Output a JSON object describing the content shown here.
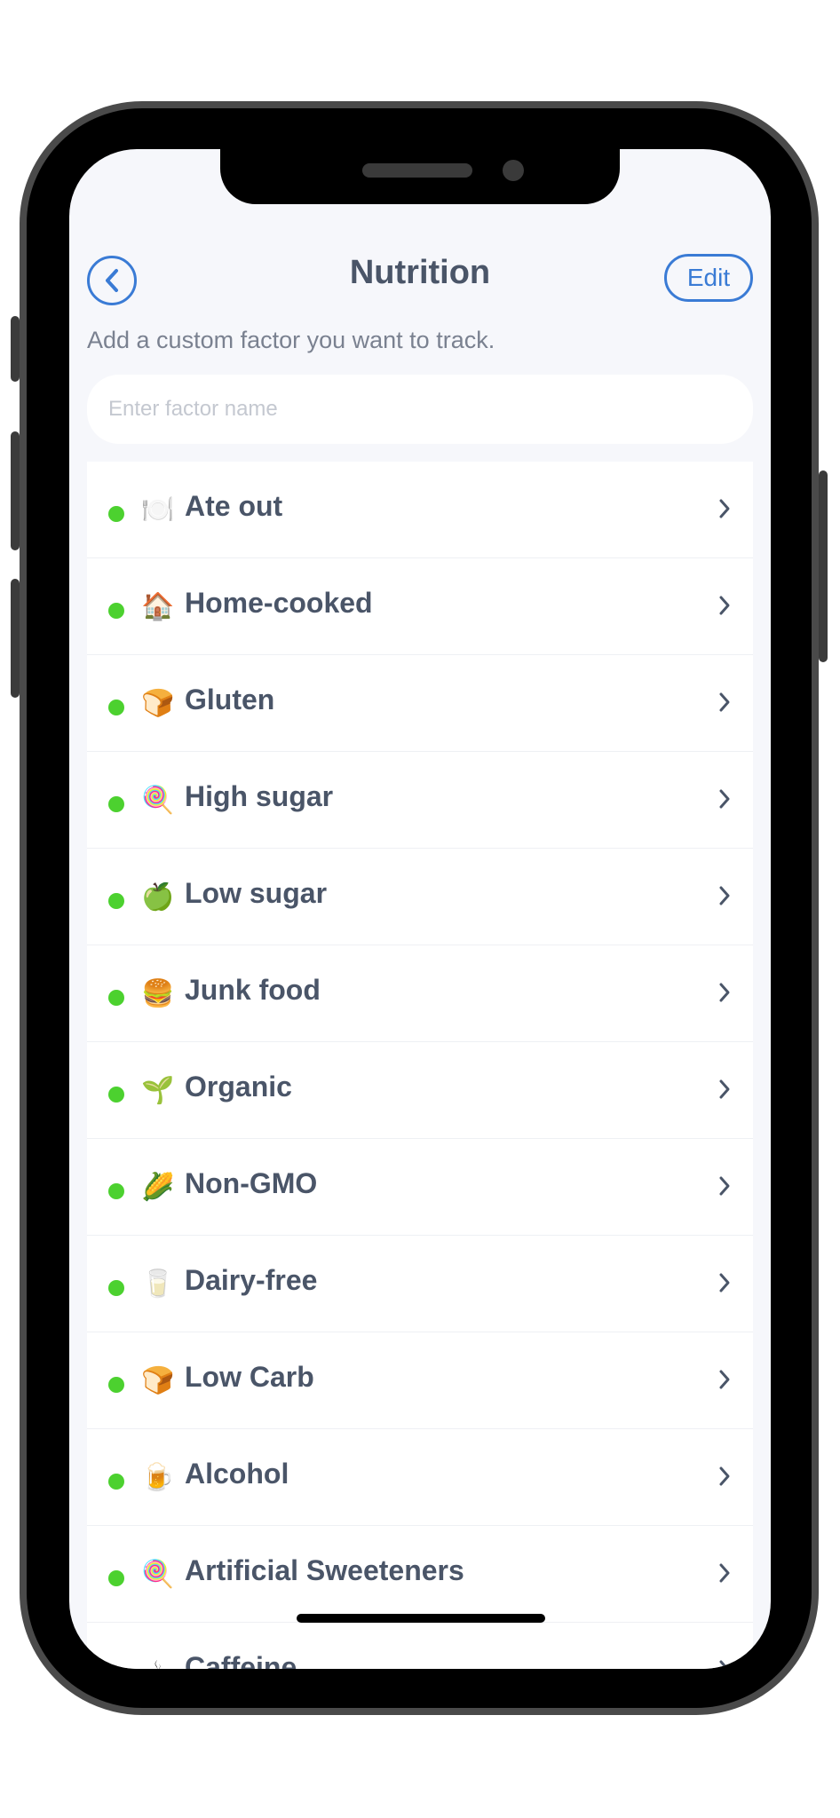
{
  "header": {
    "title": "Nutrition",
    "edit_label": "Edit"
  },
  "subtitle": "Add a custom factor you want to track.",
  "factor_input": {
    "placeholder": "Enter factor name",
    "value": ""
  },
  "colors": {
    "accent": "#3a7bd5",
    "status_dot": "#4cd12f",
    "text": "#4a5568",
    "background": "#f6f7fb"
  },
  "factors": [
    {
      "emoji": "🍽️",
      "icon": "plate-icon",
      "label": "Ate out"
    },
    {
      "emoji": "🏠",
      "icon": "house-icon",
      "label": "Home-cooked"
    },
    {
      "emoji": "🍞",
      "icon": "bread-icon",
      "label": "Gluten"
    },
    {
      "emoji": "🍭",
      "icon": "lollipop-icon",
      "label": "High sugar"
    },
    {
      "emoji": "🍏",
      "icon": "green-apple-icon",
      "label": "Low sugar"
    },
    {
      "emoji": "🍔",
      "icon": "burger-icon",
      "label": "Junk food"
    },
    {
      "emoji": "🌱",
      "icon": "seedling-icon",
      "label": "Organic"
    },
    {
      "emoji": "🌽",
      "icon": "corn-icon",
      "label": "Non-GMO"
    },
    {
      "emoji": "🥛",
      "icon": "milk-glass-icon",
      "label": "Dairy-free"
    },
    {
      "emoji": "🍞",
      "icon": "bread-icon",
      "label": "Low Carb"
    },
    {
      "emoji": "🍺",
      "icon": "beer-mug-icon",
      "label": "Alcohol"
    },
    {
      "emoji": "🍭",
      "icon": "lollipop-icon",
      "label": "Artificial Sweeteners"
    },
    {
      "emoji": "☕",
      "icon": "coffee-icon",
      "label": "Caffeine"
    }
  ]
}
